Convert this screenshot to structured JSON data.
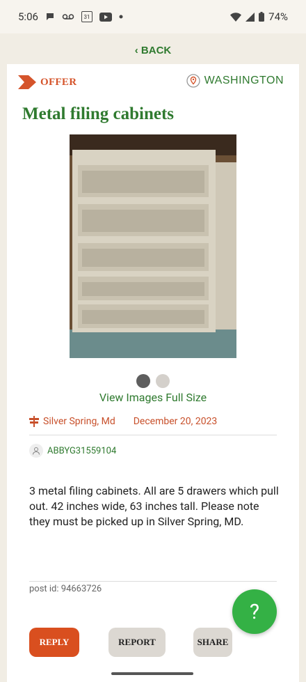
{
  "status_bar": {
    "time": "5:06",
    "calendar_day": "31",
    "battery": "74%",
    "icons": [
      "chat-bubble-icon",
      "voicemail-icon",
      "calendar-icon",
      "youtube-icon",
      "dot-icon",
      "wifi-icon",
      "signal-icon",
      "battery-icon"
    ]
  },
  "nav": {
    "back_label": "‹ BACK"
  },
  "post": {
    "type_label": "OFFER",
    "location_label": "WASHINGTON",
    "title": "Metal filing cabinets",
    "view_images_label": "View Images Full Size",
    "image_count": 2,
    "active_image": 1,
    "place": "Silver Spring, Md",
    "date": "December 20, 2023",
    "username": "ABBYG31559104",
    "description": "3 metal filing cabinets. All are 5 drawers which pull out. 42 inches wide, 63 inches tall. Please note they must be picked up in Silver Spring, MD.",
    "post_id": "post id: 94663726"
  },
  "actions": {
    "reply_label": "REPLY",
    "report_label": "REPORT",
    "share_label": "SHARE",
    "help_label": "?"
  },
  "colors": {
    "brand_green": "#2f7a2f",
    "offer_orange": "#d5542b",
    "reply_orange": "#d94f1f",
    "help_green": "#34b145",
    "background": "#f1ede4"
  }
}
